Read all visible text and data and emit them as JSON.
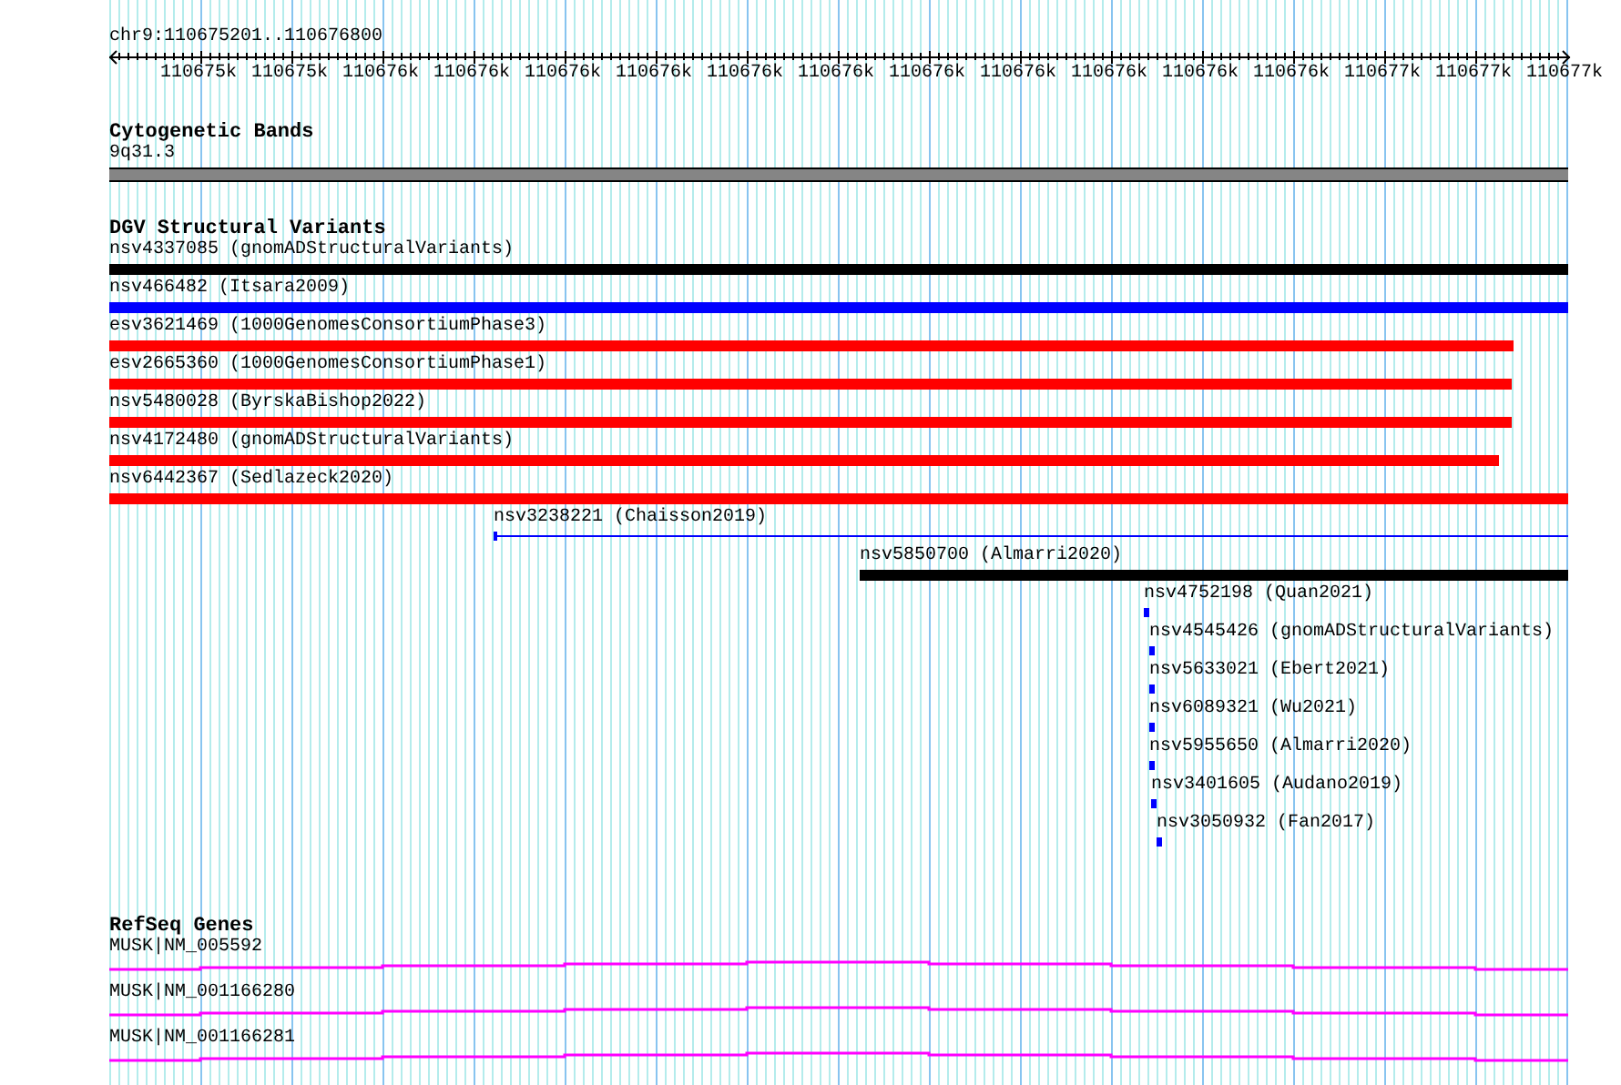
{
  "locus": "chr9:110675201..110676800",
  "ruler": {
    "labels": [
      "110675k",
      "110675k",
      "110676k",
      "110676k",
      "110676k",
      "110676k",
      "110676k",
      "110676k",
      "110676k",
      "110676k",
      "110676k",
      "110676k",
      "110676k",
      "110677k",
      "110677k",
      "110677k"
    ]
  },
  "tracks": [
    {
      "kind": "bands",
      "title": "Cytogenetic Bands",
      "features": [
        {
          "label": "9q31.3"
        }
      ]
    },
    {
      "kind": "variants",
      "title": "DGV Structural Variants",
      "features": [
        {
          "label": "nsv4337085 (gnomADStructuralVariants)",
          "color": "#000000"
        },
        {
          "label": "nsv466482 (Itsara2009)",
          "color": "#0000ff"
        },
        {
          "label": "esv3621469 (1000GenomesConsortiumPhase3)",
          "color": "#ff0000"
        },
        {
          "label": "esv2665360 (1000GenomesConsortiumPhase1)",
          "color": "#ff0000"
        },
        {
          "label": "nsv5480028 (ByrskaBishop2022)",
          "color": "#ff0000"
        },
        {
          "label": "nsv4172480 (gnomADStructuralVariants)",
          "color": "#ff0000"
        },
        {
          "label": "nsv6442367 (Sedlazeck2020)",
          "color": "#ff0000"
        },
        {
          "label": "nsv3238221 (Chaisson2019)",
          "color": "#0000ff"
        },
        {
          "label": "nsv5850700 (Almarri2020)",
          "color": "#000000"
        },
        {
          "label": "nsv4752198 (Quan2021)",
          "color": "#0000ff"
        },
        {
          "label": "nsv4545426 (gnomADStructuralVariants)",
          "color": "#0000ff"
        },
        {
          "label": "nsv5633021 (Ebert2021)",
          "color": "#0000ff"
        },
        {
          "label": "nsv6089321 (Wu2021)",
          "color": "#0000ff"
        },
        {
          "label": "nsv5955650 (Almarri2020)",
          "color": "#0000ff"
        },
        {
          "label": "nsv3401605 (Audano2019)",
          "color": "#0000ff"
        },
        {
          "label": "nsv3050932 (Fan2017)",
          "color": "#0000ff"
        }
      ]
    },
    {
      "kind": "genes",
      "title": "RefSeq Genes",
      "features": [
        {
          "label": "MUSK|NM_005592"
        },
        {
          "label": "MUSK|NM_001166280"
        },
        {
          "label": "MUSK|NM_001166281"
        }
      ]
    }
  ]
}
